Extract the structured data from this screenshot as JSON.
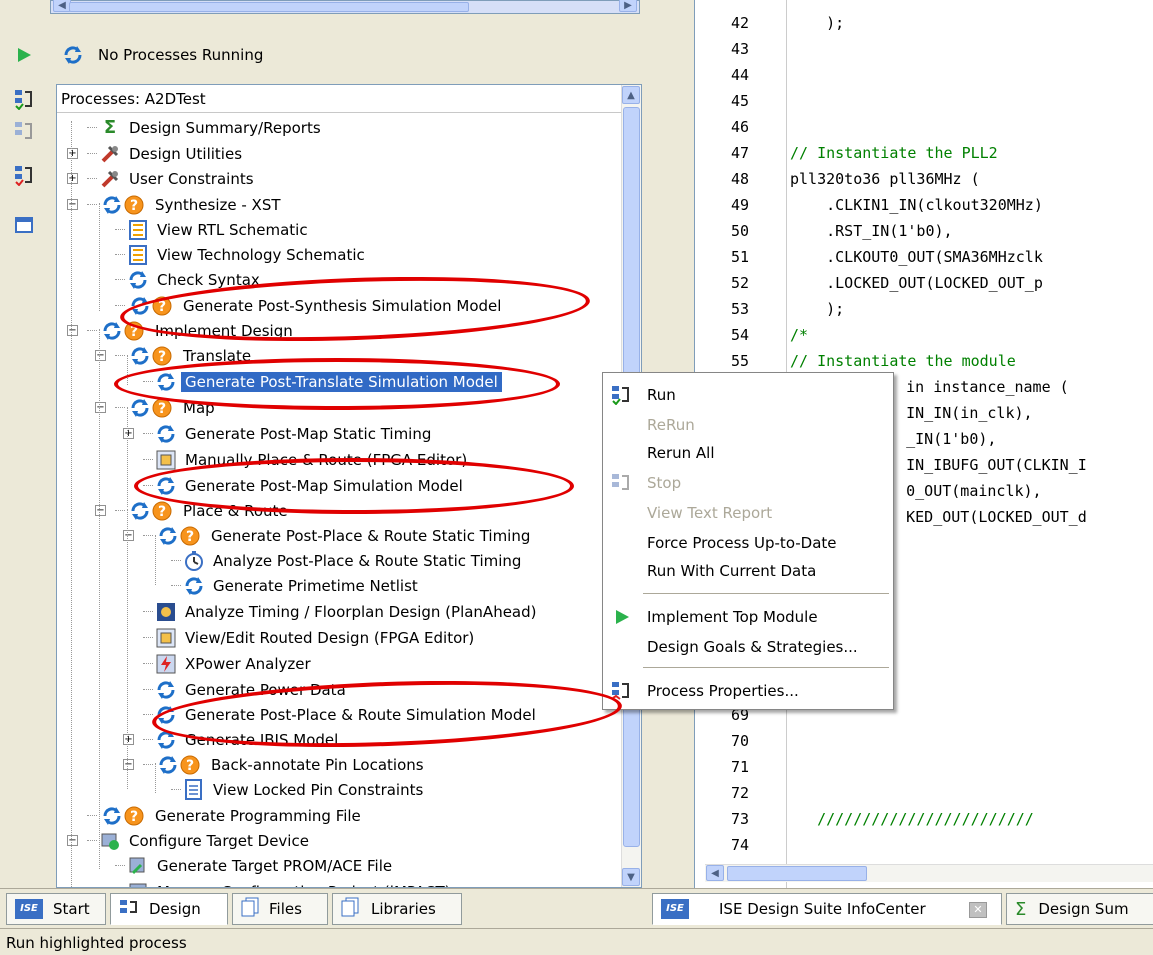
{
  "status_bar": {
    "text": "Run highlighted process"
  },
  "process_status": {
    "text": "No Processes Running"
  },
  "process_panel": {
    "header": "Processes: A2DTest",
    "items": [
      {
        "label": "Design Summary/Reports",
        "icon": "sigma-icon"
      },
      {
        "label": "Design Utilities",
        "icon": "tools-icon"
      },
      {
        "label": "User Constraints",
        "icon": "tools-icon"
      },
      {
        "label": "Synthesize - XST",
        "icon": "refresh-warning-icon"
      },
      {
        "label": "View RTL Schematic",
        "icon": "schematic-icon"
      },
      {
        "label": "View Technology Schematic",
        "icon": "schematic-icon"
      },
      {
        "label": "Check Syntax",
        "icon": "refresh-icon"
      },
      {
        "label": "Generate Post-Synthesis Simulation Model",
        "icon": "refresh-warning-icon"
      },
      {
        "label": "Implement Design",
        "icon": "refresh-warning-icon"
      },
      {
        "label": "Translate",
        "icon": "refresh-warning-icon"
      },
      {
        "label": "Generate Post-Translate Simulation Model",
        "icon": "refresh-icon"
      },
      {
        "label": "Map",
        "icon": "refresh-warning-icon"
      },
      {
        "label": "Generate Post-Map Static Timing",
        "icon": "refresh-icon"
      },
      {
        "label": "Manually Place & Route (FPGA Editor)",
        "icon": "fpga-editor-icon"
      },
      {
        "label": "Generate Post-Map Simulation Model",
        "icon": "refresh-icon"
      },
      {
        "label": "Place & Route",
        "icon": "refresh-warning-icon"
      },
      {
        "label": "Generate Post-Place & Route Static Timing",
        "icon": "refresh-warning-icon"
      },
      {
        "label": "Analyze Post-Place & Route Static Timing",
        "icon": "stopwatch-icon"
      },
      {
        "label": "Generate Primetime Netlist",
        "icon": "refresh-icon"
      },
      {
        "label": "Analyze Timing / Floorplan Design (PlanAhead)",
        "icon": "planahead-icon"
      },
      {
        "label": "View/Edit Routed Design (FPGA Editor)",
        "icon": "fpga-editor-icon"
      },
      {
        "label": "XPower Analyzer",
        "icon": "xpower-icon"
      },
      {
        "label": "Generate Power Data",
        "icon": "refresh-icon"
      },
      {
        "label": "Generate Post-Place & Route Simulation Model",
        "icon": "refresh-icon"
      },
      {
        "label": "Generate IBIS Model",
        "icon": "refresh-icon"
      },
      {
        "label": "Back-annotate Pin Locations",
        "icon": "refresh-warning-icon"
      },
      {
        "label": "View Locked Pin Constraints",
        "icon": "document-icon"
      },
      {
        "label": "Generate Programming File",
        "icon": "refresh-warning-icon"
      },
      {
        "label": "Configure Target Device",
        "icon": "device-icon"
      },
      {
        "label": "Generate Target PROM/ACE File",
        "icon": "prom-icon"
      },
      {
        "label": "Manage Configuration Project (iMPACT)",
        "icon": "impact-icon"
      }
    ]
  },
  "left_tabs": [
    {
      "label": "Start"
    },
    {
      "label": "Design"
    },
    {
      "label": "Files"
    },
    {
      "label": "Libraries"
    }
  ],
  "right_tabs": [
    {
      "label": "ISE Design Suite InfoCenter"
    },
    {
      "label": "Design Sum"
    }
  ],
  "code": {
    "lines": [
      {
        "n": "42",
        "text": "    );"
      },
      {
        "n": "43",
        "text": ""
      },
      {
        "n": "44",
        "text": ""
      },
      {
        "n": "45",
        "text": ""
      },
      {
        "n": "46",
        "text": ""
      },
      {
        "n": "47",
        "text": "// Instantiate the PLL2"
      },
      {
        "n": "48",
        "text": "pll320to36 pll36MHz ("
      },
      {
        "n": "49",
        "text": "    .CLKIN1_IN(clkout320MHz)"
      },
      {
        "n": "50",
        "text": "    .RST_IN(1'b0),"
      },
      {
        "n": "51",
        "text": "    .CLKOUT0_OUT(SMA36MHzclk"
      },
      {
        "n": "52",
        "text": "    .LOCKED_OUT(LOCKED_OUT_p"
      },
      {
        "n": "53",
        "text": "    );"
      },
      {
        "n": "54",
        "text": "/*"
      },
      {
        "n": "55",
        "text": "// Instantiate the module"
      },
      {
        "n": "56",
        "text": "    in instance_name ("
      },
      {
        "n": "57",
        "text": "    IN_IN(in_clk),"
      },
      {
        "n": "58",
        "text": "    _IN(1'b0),"
      },
      {
        "n": "59",
        "text": "    IN_IBUFG_OUT(CLKIN_I"
      },
      {
        "n": "60",
        "text": "    0_OUT(mainclk),"
      },
      {
        "n": "61",
        "text": "    KED_OUT(LOCKED_OUT_d"
      },
      {
        "n": "69",
        "text": ""
      },
      {
        "n": "70",
        "text": ""
      },
      {
        "n": "71",
        "text": ""
      },
      {
        "n": "72",
        "text": ""
      },
      {
        "n": "73",
        "text": "   ////////////////////////"
      },
      {
        "n": "74",
        "text": ""
      }
    ]
  },
  "context_menu": {
    "items": [
      {
        "label": "Run",
        "enabled": true,
        "icon": "run-process-icon"
      },
      {
        "label": "ReRun",
        "enabled": false
      },
      {
        "label": "Rerun All",
        "enabled": true
      },
      {
        "label": "Stop",
        "enabled": false,
        "icon": "stop-process-icon"
      },
      {
        "label": "View Text Report",
        "enabled": false
      },
      {
        "label": "Force Process Up-to-Date",
        "enabled": true
      },
      {
        "label": "Run With Current Data",
        "enabled": true
      },
      {
        "label": "Implement Top Module",
        "enabled": true,
        "icon": "play-icon"
      },
      {
        "label": "Design Goals & Strategies...",
        "enabled": true
      },
      {
        "label": "Process Properties...",
        "enabled": true,
        "icon": "properties-icon"
      }
    ]
  },
  "colors": {
    "selection": "#316ac5",
    "annotation_red": "#e00000",
    "comment_green": "#008000",
    "warning_orange": "#f7941d",
    "refresh_blue": "#1e6fc8"
  }
}
